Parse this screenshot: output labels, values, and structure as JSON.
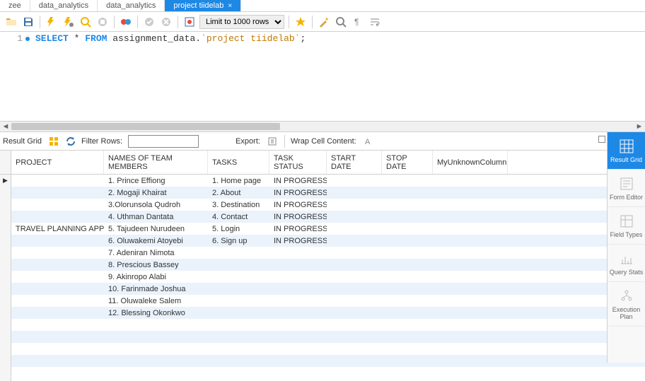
{
  "tabs": [
    {
      "label": "zee",
      "active": false
    },
    {
      "label": "data_analytics",
      "active": false
    },
    {
      "label": "data_analytics",
      "active": false
    },
    {
      "label": "project tiidelab",
      "active": true
    }
  ],
  "toolbar": {
    "limit_label": "Limit to 1000 rows"
  },
  "editor": {
    "line_number": "1",
    "sql_select": "SELECT",
    "sql_star_from": " * ",
    "sql_from": "FROM",
    "sql_table": " assignment_data.",
    "sql_string": "`project tiidelab`",
    "sql_semicolon": ";"
  },
  "results_toolbar": {
    "label": "Result Grid",
    "filter_label": "Filter Rows:",
    "filter_value": "",
    "export_label": "Export:",
    "wrap_label": "Wrap Cell Content:"
  },
  "grid": {
    "columns": [
      "PROJECT",
      "NAMES OF TEAM MEMBERS",
      "TASKS",
      "TASK STATUS",
      "START DATE",
      "STOP DATE",
      "MyUnknownColumn"
    ],
    "rows": [
      {
        "project": "",
        "name": "1. Prince Effiong",
        "task": "1. Home page",
        "status": "IN PROGRESS",
        "start": "",
        "stop": "",
        "unknown": ""
      },
      {
        "project": "",
        "name": "2. Mogaji Khairat",
        "task": "2. About",
        "status": "IN PROGRESS",
        "start": "",
        "stop": "",
        "unknown": ""
      },
      {
        "project": "",
        "name": "3.Olorunsola Qudroh",
        "task": "3. Destination",
        "status": "IN PROGRESS",
        "start": "",
        "stop": "",
        "unknown": ""
      },
      {
        "project": "",
        "name": "4. Uthman Dantata",
        "task": "4. Contact",
        "status": "IN PROGRESS",
        "start": "",
        "stop": "",
        "unknown": ""
      },
      {
        "project": "TRAVEL PLANNING APP",
        "name": "5. Tajudeen Nurudeen",
        "task": "5. Login",
        "status": "IN PROGRESS",
        "start": "",
        "stop": "",
        "unknown": ""
      },
      {
        "project": "",
        "name": "6. Oluwakemi Atoyebi",
        "task": "6. Sign up",
        "status": "IN PROGRESS",
        "start": "",
        "stop": "",
        "unknown": ""
      },
      {
        "project": "",
        "name": "7. Adeniran Nimota",
        "task": "",
        "status": "",
        "start": "",
        "stop": "",
        "unknown": ""
      },
      {
        "project": "",
        "name": "8. Prescious Bassey",
        "task": "",
        "status": "",
        "start": "",
        "stop": "",
        "unknown": ""
      },
      {
        "project": "",
        "name": "9. Akinropo Alabi",
        "task": "",
        "status": "",
        "start": "",
        "stop": "",
        "unknown": ""
      },
      {
        "project": "",
        "name": "10. Farinmade Joshua",
        "task": "",
        "status": "",
        "start": "",
        "stop": "",
        "unknown": ""
      },
      {
        "project": "",
        "name": "11. Oluwaleke Salem",
        "task": "",
        "status": "",
        "start": "",
        "stop": "",
        "unknown": ""
      },
      {
        "project": "",
        "name": "12. Blessing Okonkwo",
        "task": "",
        "status": "",
        "start": "",
        "stop": "",
        "unknown": ""
      },
      {
        "project": "",
        "name": "",
        "task": "",
        "status": "",
        "start": "",
        "stop": "",
        "unknown": ""
      },
      {
        "project": "",
        "name": "",
        "task": "",
        "status": "",
        "start": "",
        "stop": "",
        "unknown": ""
      },
      {
        "project": "",
        "name": "",
        "task": "",
        "status": "",
        "start": "",
        "stop": "",
        "unknown": ""
      },
      {
        "project": "",
        "name": "",
        "task": "",
        "status": "",
        "start": "",
        "stop": "",
        "unknown": ""
      },
      {
        "project": "",
        "name": "",
        "task": "",
        "status": "",
        "start": "",
        "stop": "",
        "unknown": ""
      }
    ]
  },
  "side_panel": [
    {
      "label": "Result Grid",
      "active": true
    },
    {
      "label": "Form Editor",
      "active": false
    },
    {
      "label": "Field Types",
      "active": false
    },
    {
      "label": "Query Stats",
      "active": false
    },
    {
      "label": "Execution Plan",
      "active": false
    }
  ]
}
